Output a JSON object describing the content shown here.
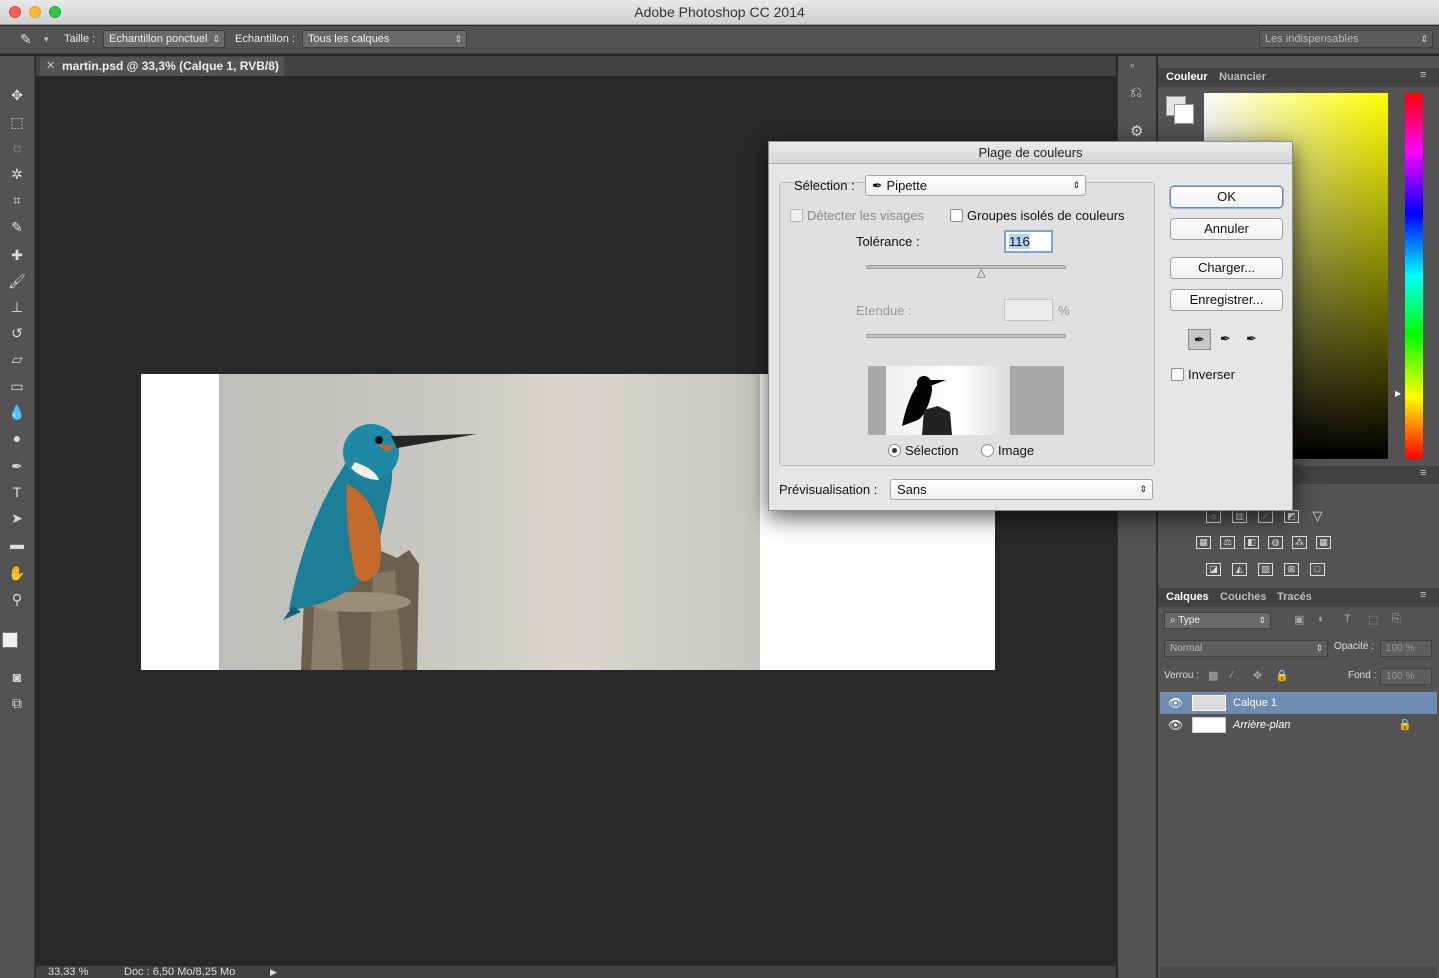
{
  "window": {
    "title": "Adobe Photoshop CC 2014"
  },
  "options_bar": {
    "size_label": "Taille :",
    "size_value": "Echantillon ponctuel",
    "sample_label": "Echantillon :",
    "sample_value": "Tous les calques",
    "workspace": "Les indispensables"
  },
  "document": {
    "tab_title": "martin.psd @ 33,3% (Calque 1, RVB/8)",
    "zoom": "33,33 %",
    "doc_info": "Doc : 6,50 Mo/8,25 Mo"
  },
  "color_panel": {
    "tabs": [
      "Couleur",
      "Nuancier"
    ]
  },
  "layers_panel": {
    "tabs": [
      "Calques",
      "Couches",
      "Tracés"
    ],
    "filter": "Type",
    "blend_mode": "Normal",
    "opacity_label": "Opacité :",
    "opacity_value": "100 %",
    "lock_label": "Verrou :",
    "fill_label": "Fond :",
    "fill_value": "100 %",
    "layers": [
      {
        "name": "Calque 1",
        "selected": true
      },
      {
        "name": "Arrière-plan",
        "selected": false,
        "locked": true
      }
    ]
  },
  "dialog": {
    "title": "Plage de couleurs",
    "selection_label": "Sélection :",
    "selection_value": "Pipette",
    "detect_faces": "Détecter les visages",
    "clustered": "Groupes isolés de couleurs",
    "tolerance_label": "Tolérance :",
    "tolerance_value": "116",
    "tolerance_fraction": 0.58,
    "range_label": "Etendue :",
    "range_unit": "%",
    "preview_modes": [
      "Sélection",
      "Image"
    ],
    "preview_label": "Prévisualisation :",
    "preview_value": "Sans",
    "buttons": {
      "ok": "OK",
      "cancel": "Annuler",
      "load": "Charger...",
      "save": "Enregistrer..."
    },
    "invert_label": "Inverser"
  },
  "colors": {
    "accent_selection": "#6f8bb0",
    "dialog_bg": "#e6e6e6",
    "panel_bg": "#535353"
  }
}
